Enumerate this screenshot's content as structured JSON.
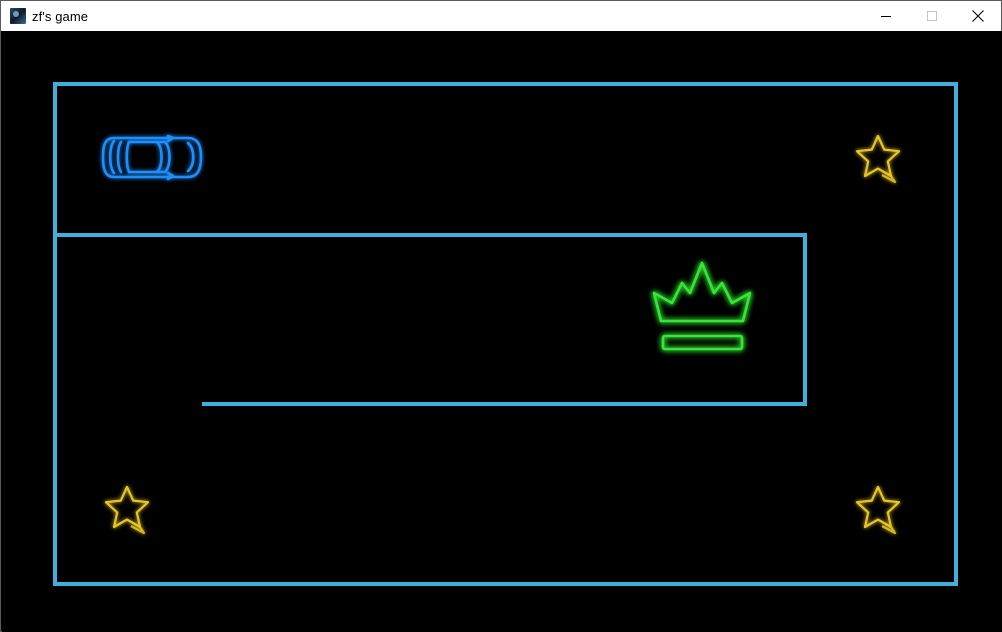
{
  "window": {
    "title": "zf's game",
    "controls": {
      "minimize_icon": "minimize-icon",
      "maximize_icon": "maximize-icon",
      "close_icon": "close-icon"
    }
  },
  "game": {
    "background_color": "#000000",
    "wall_color": "#3fb0dc",
    "player": {
      "type": "car",
      "icon": "car-icon",
      "color": "#1e8fff"
    },
    "goal": {
      "type": "crown",
      "icon": "crown-icon",
      "color": "#36e636"
    },
    "stars": [
      {
        "icon": "star-icon",
        "color": "#e8c624"
      },
      {
        "icon": "star-icon",
        "color": "#e8c624"
      },
      {
        "icon": "star-icon",
        "color": "#e8c624"
      }
    ]
  }
}
